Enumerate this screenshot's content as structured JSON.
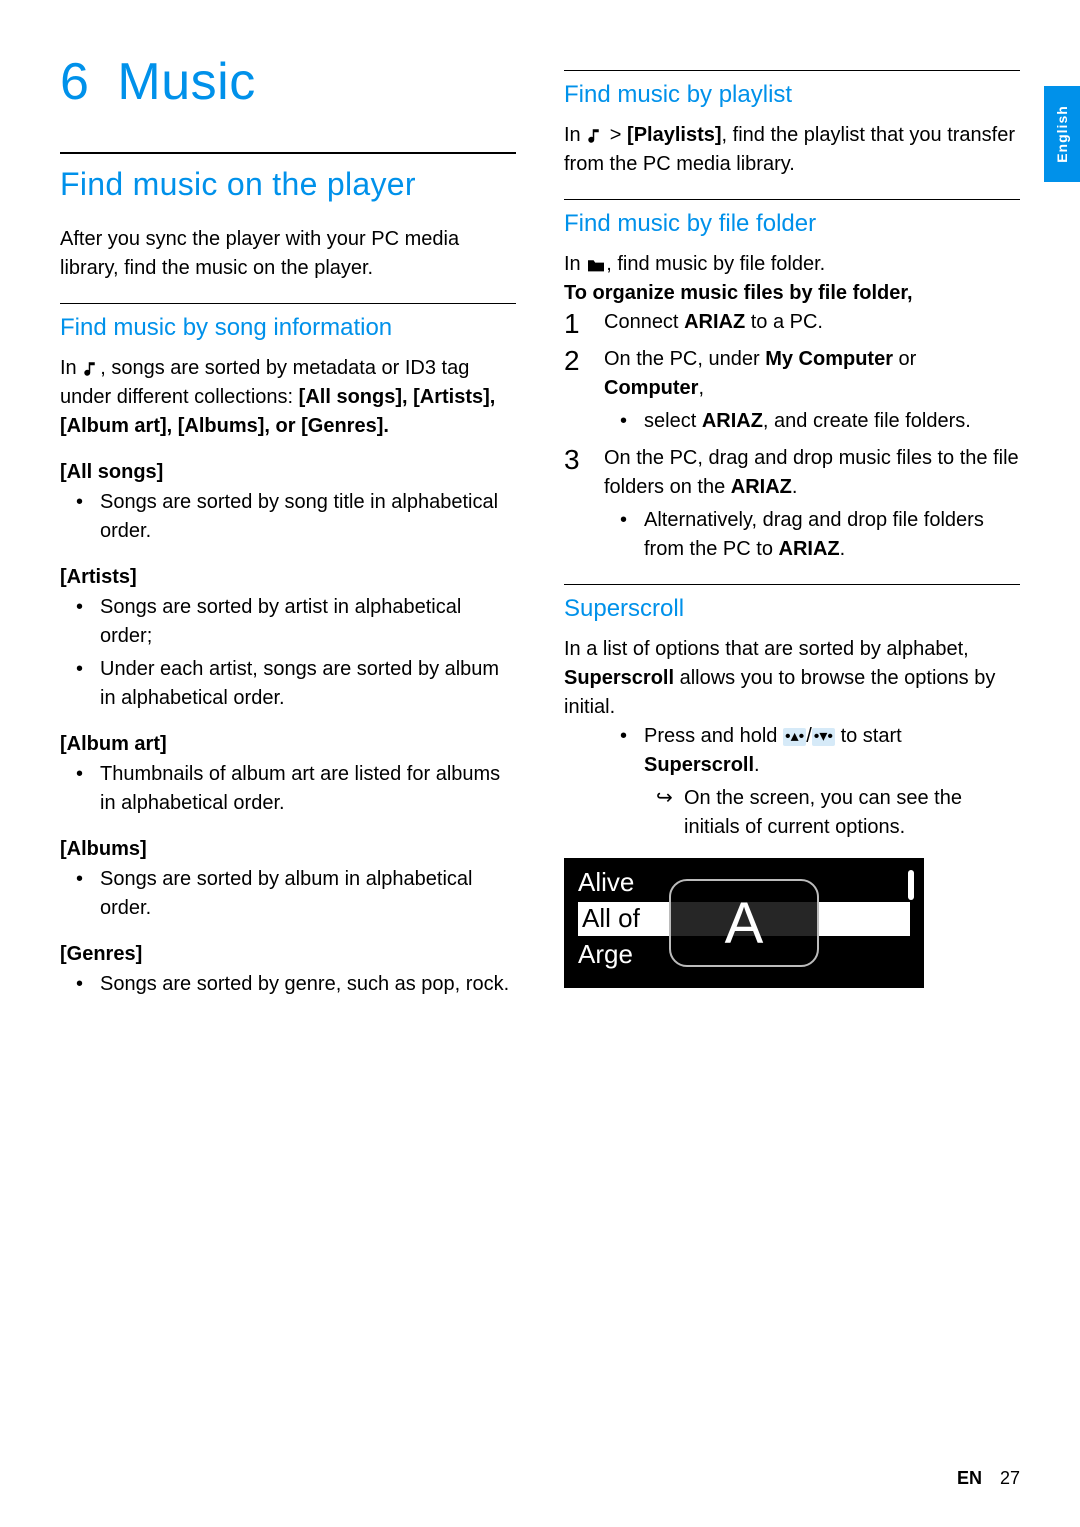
{
  "lang_tab": "English",
  "chapter": {
    "number": "6",
    "title": "Music"
  },
  "left": {
    "h1": "Find music on the player",
    "intro": "After you sync the player with your PC media library, find the music on the player.",
    "h2": "Find music by song information",
    "para_pre": "In ",
    "para_post": ", songs are sorted by metadata or ID3 tag under different collections: ",
    "collections": "[All songs], [Artists], [Album art], [Albums], or [Genres].",
    "allsongs": {
      "title": "[All songs]",
      "b1": "Songs are sorted by song title in alphabetical order."
    },
    "artists": {
      "title": "[Artists]",
      "b1": "Songs are sorted by artist in alphabetical order;",
      "b2": "Under each artist, songs are sorted by album in alphabetical order."
    },
    "albumart": {
      "title": "[Album art]",
      "b1": "Thumbnails of album art are listed for albums in alphabetical order."
    },
    "albums": {
      "title": "[Albums]",
      "b1": "Songs are sorted by album in alphabetical order."
    },
    "genres": {
      "title": "[Genres]",
      "b1": "Songs are sorted by genre, such as pop, rock."
    }
  },
  "right": {
    "playlist": {
      "h2": "Find music by playlist",
      "pre": "In ",
      "mid": " > ",
      "bold": "[Playlists]",
      "post": ", find the playlist that you transfer from the PC media library."
    },
    "folder": {
      "h2": "Find music by file folder",
      "line1_pre": "In ",
      "line1_post": ", find music by file folder.",
      "line2": "To organize music files by file folder,",
      "step1_pre": "Connect ",
      "step1_bold": "ARIAZ",
      "step1_post": " to a PC.",
      "step2_pre": "On the PC, under ",
      "step2_b1": "My Computer",
      "step2_mid": " or ",
      "step2_b2": "Computer",
      "step2_post": ",",
      "step2_sub_pre": "select ",
      "step2_sub_bold": "ARIAZ",
      "step2_sub_post": ", and create file folders.",
      "step3_pre": "On the PC, drag and drop music files to the file folders on the ",
      "step3_bold": "ARIAZ",
      "step3_post": ".",
      "step3_sub_pre": "Alternatively, drag and drop file folders from the PC to ",
      "step3_sub_bold": "ARIAZ",
      "step3_sub_post": "."
    },
    "superscroll": {
      "h2": "Superscroll",
      "para_pre": "In a list of options that are sorted by alphabet, ",
      "para_bold": "Superscroll",
      "para_post": " allows you to browse the options by initial.",
      "b1_pre": "Press and hold ",
      "b1_mid": "/",
      "b1_post": " to start ",
      "b1_bold": "Superscroll",
      "b1_end": ".",
      "arrow": "On the screen, you can see the initials of current options.",
      "img_row1": "Alive",
      "img_row2": "All of",
      "img_row3": "Arge",
      "img_letter": "A"
    }
  },
  "footer": {
    "lang": "EN",
    "page": "27"
  }
}
